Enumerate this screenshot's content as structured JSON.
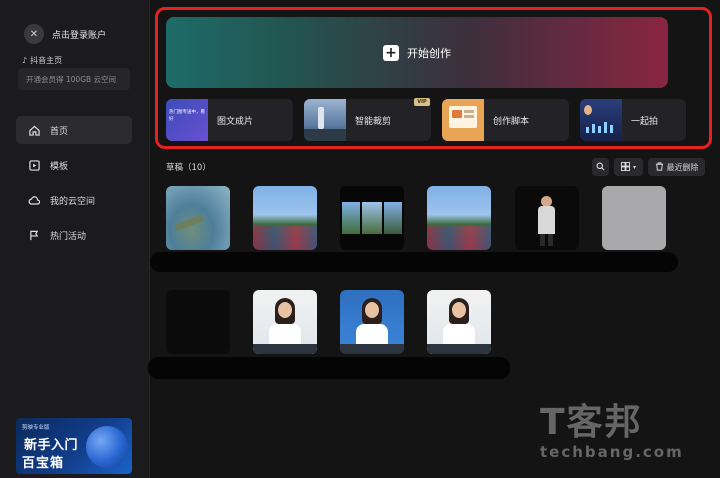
{
  "sidebar": {
    "login_text": "点击登录账户",
    "douyin_label": "抖音主页",
    "membership_text": "开通会员得 100GB 云空间",
    "nav": [
      {
        "label": "首页",
        "icon": "home-icon"
      },
      {
        "label": "模板",
        "icon": "template-icon"
      },
      {
        "label": "我的云空间",
        "icon": "cloud-icon"
      },
      {
        "label": "热门活动",
        "icon": "flag-icon"
      }
    ],
    "promo": {
      "brand": "剪映专业版",
      "title_line1": "新手入门",
      "title_line2": "百宝箱"
    }
  },
  "main": {
    "start_label": "开始创作",
    "tools": [
      {
        "label": "图文成片",
        "thumb_text": "热门图专送中，看好"
      },
      {
        "label": "智能裁剪",
        "badge": "VIP"
      },
      {
        "label": "创作脚本"
      },
      {
        "label": "一起拍"
      }
    ],
    "drafts_title": "草稿（10）",
    "recent_delete": "最近删除"
  },
  "watermark": {
    "cn": "T客邦",
    "en": "techbang.com"
  },
  "colors": {
    "highlight_border": "#e52222",
    "background": "#141414"
  }
}
